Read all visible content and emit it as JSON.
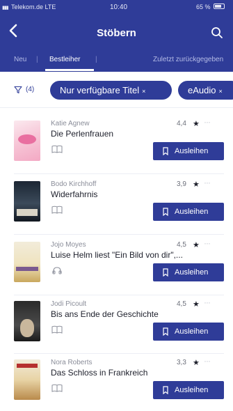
{
  "status": {
    "carrier": "Telekom.de  LTE",
    "time": "10:40",
    "battery": "65 %"
  },
  "header": {
    "title": "Stöbern",
    "back_icon": "chevron-left-icon",
    "search_icon": "search-icon"
  },
  "tabs": [
    {
      "label": "Neu",
      "active": false
    },
    {
      "label": "Bestleiher",
      "active": true
    },
    {
      "label": "Zuletzt zurückgegeben",
      "active": false
    }
  ],
  "filters": {
    "count": "(4)",
    "chips": [
      {
        "label": "Nur verfügbare Titel",
        "close": "×"
      },
      {
        "label": "eAudio",
        "close": "×"
      }
    ]
  },
  "colors": {
    "brand": "#2f3c98",
    "background": "#ffffff",
    "muted_text": "#8a8d99"
  },
  "borrow_label": "Ausleihen",
  "books": [
    {
      "author": "Katie Agnew",
      "title": "Die Perlenfrauen",
      "rating": "4,4",
      "format": "ebook"
    },
    {
      "author": "Bodo Kirchhoff",
      "title": "Widerfahrnis",
      "rating": "3,9",
      "format": "ebook"
    },
    {
      "author": "Jojo Moyes",
      "title": "Luise Helm liest \"Ein Bild von dir\",...",
      "rating": "4,5",
      "format": "audiobook"
    },
    {
      "author": "Jodi Picoult",
      "title": "Bis ans Ende der Geschichte",
      "rating": "4,5",
      "format": "ebook"
    },
    {
      "author": "Nora Roberts",
      "title": "Das Schloss in Frankreich",
      "rating": "3,3",
      "format": "ebook"
    }
  ]
}
